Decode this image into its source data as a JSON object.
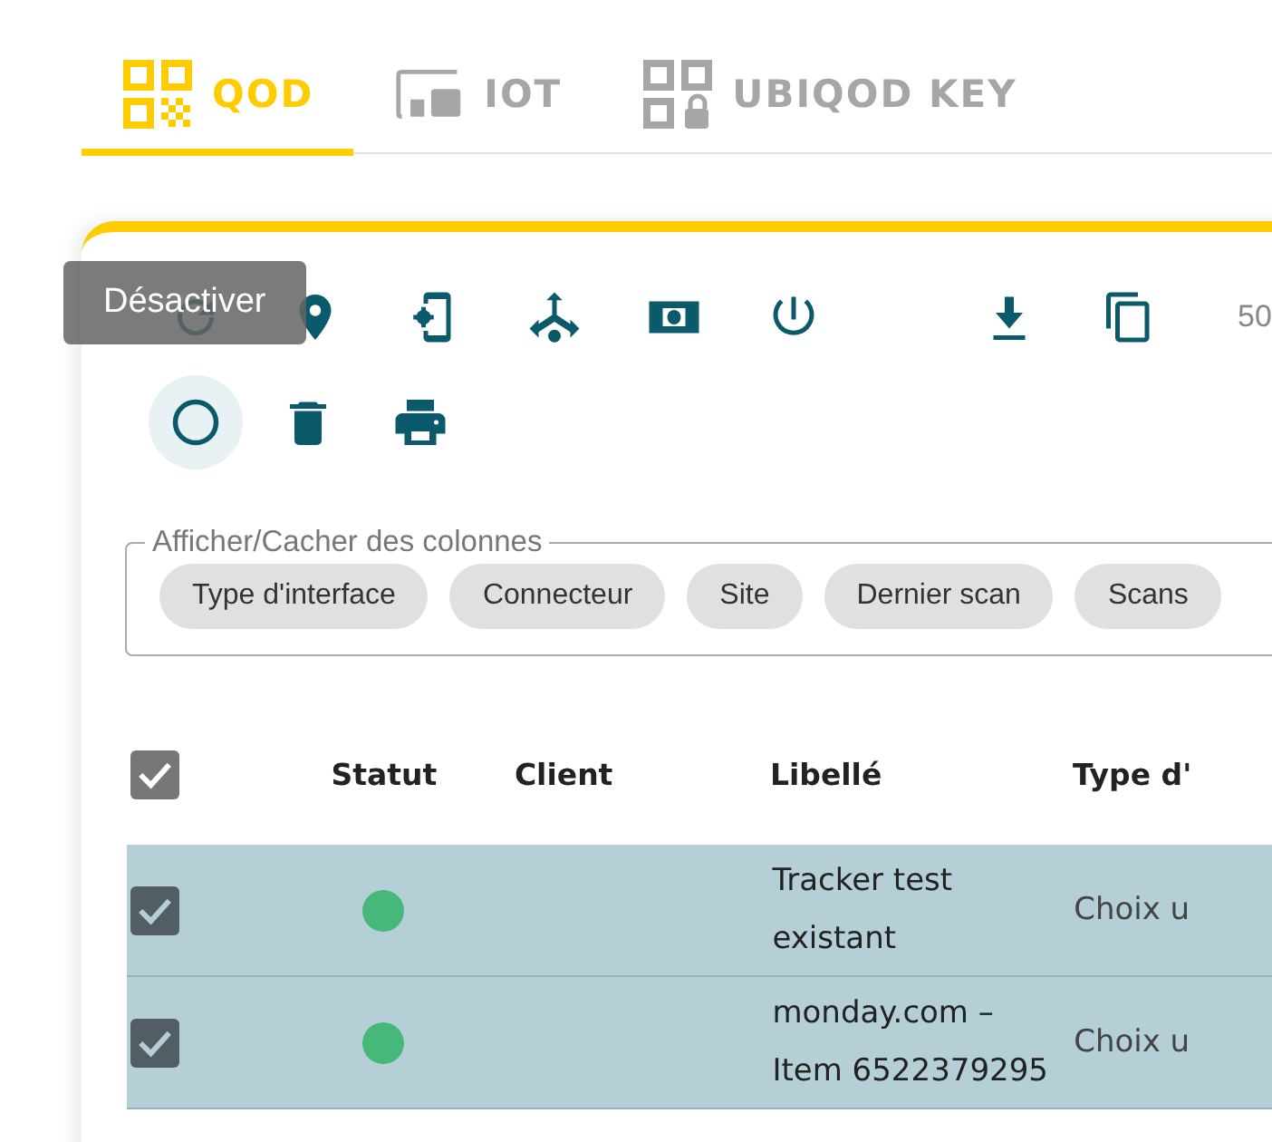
{
  "tabs": [
    {
      "label": "QOD",
      "kind": "qr",
      "selected": true
    },
    {
      "label": "IOT",
      "kind": "iot",
      "selected": false
    },
    {
      "label": "UBIQOD KEY",
      "kind": "key",
      "selected": false
    }
  ],
  "toolbar": {
    "row_1": [
      {
        "kind": "refresh"
      },
      {
        "kind": "pin"
      },
      {
        "kind": "phone-gear"
      },
      {
        "kind": "split"
      },
      {
        "kind": "money"
      },
      {
        "kind": "power"
      },
      {
        "kind": "download"
      },
      {
        "kind": "copy"
      }
    ],
    "page_size": "50",
    "row_2": [
      {
        "kind": "circle",
        "hovered": true
      },
      {
        "kind": "trash",
        "hovered": false
      },
      {
        "kind": "printer",
        "hovered": false
      }
    ],
    "tooltip": "Désactiver"
  },
  "column_toggle": {
    "legend": "Afficher/Cacher des colonnes",
    "chips": [
      "Type d'interface",
      "Connecteur",
      "Site",
      "Dernier scan",
      "Scans"
    ]
  },
  "table": {
    "all_checked": true,
    "columns": [
      "Statut",
      "Client",
      "Libellé",
      "Type d'"
    ],
    "rows": [
      {
        "checked": true,
        "color": "#46b97a",
        "label": "Tracker test existant",
        "type": "Choix u"
      },
      {
        "checked": true,
        "color": "#46b97a",
        "label": "monday.com – Item 6522379295",
        "type": "Choix u"
      }
    ]
  }
}
